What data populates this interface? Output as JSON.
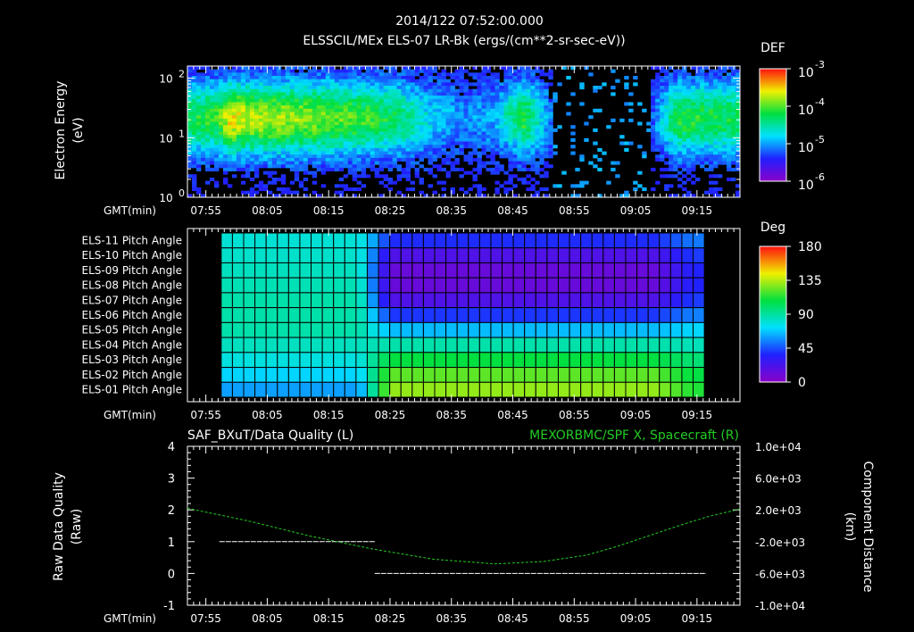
{
  "header": {
    "datetime": "2014/122 07:52:00.000",
    "instrument_title": "ELSSCIL/MEx ELS-07 LR-Bk  (ergs/(cm**2-sr-sec-eV))"
  },
  "colors": {
    "background": "#000000",
    "axes": "#ffffff",
    "series_left": "#ffffff",
    "series_right": "#22cc22"
  },
  "chart_data": [
    {
      "type": "heatmap",
      "panel": "spectrogram",
      "ylabel_line1": "Electron Energy",
      "ylabel_line2": "(eV)",
      "xlabel": "GMT(min)",
      "y_scale": "log",
      "ylim": [
        1,
        160
      ],
      "y_ticks": [
        {
          "label": "10",
          "exp": "0",
          "value": 1
        },
        {
          "label": "10",
          "exp": "1",
          "value": 10
        },
        {
          "label": "10",
          "exp": "2",
          "value": 100
        }
      ],
      "x_ticks": [
        "07:55",
        "08:05",
        "08:15",
        "08:25",
        "08:35",
        "08:45",
        "08:55",
        "09:05",
        "09:15"
      ],
      "colorbar": {
        "title": "DEF",
        "scale": "log",
        "ticks": [
          {
            "base": "10",
            "exp": "-3"
          },
          {
            "base": "10",
            "exp": "-4"
          },
          {
            "base": "10",
            "exp": "-5"
          },
          {
            "base": "10",
            "exp": "-6"
          }
        ]
      },
      "intensity_profile": {
        "time_min": [
          0,
          5,
          7,
          10,
          20,
          30,
          35,
          40,
          45,
          50,
          55,
          60,
          65,
          70,
          75,
          80,
          85,
          89
        ],
        "level": [
          0.55,
          0.6,
          0.85,
          0.75,
          0.7,
          0.6,
          0.5,
          0.3,
          0.2,
          0.25,
          0.6,
          0.1,
          0.05,
          0.05,
          0.05,
          0.6,
          0.55,
          0.55
        ]
      }
    },
    {
      "type": "heatmap",
      "panel": "pitch_angle",
      "xlabel": "GMT(min)",
      "rows": [
        "ELS-11 Pitch Angle",
        "ELS-10 Pitch Angle",
        "ELS-09 Pitch Angle",
        "ELS-08 Pitch Angle",
        "ELS-07 Pitch Angle",
        "ELS-06 Pitch Angle",
        "ELS-05 Pitch Angle",
        "ELS-04 Pitch Angle",
        "ELS-03 Pitch Angle",
        "ELS-02 Pitch Angle",
        "ELS-01 Pitch Angle"
      ],
      "x_ticks": [
        "07:55",
        "08:05",
        "08:15",
        "08:25",
        "08:35",
        "08:45",
        "08:55",
        "09:05",
        "09:15"
      ],
      "colorbar": {
        "title": "Deg",
        "ticks": [
          "180",
          "135",
          "90",
          "45",
          "0"
        ],
        "range": [
          0,
          180
        ]
      },
      "time_columns": {
        "start_min": 5.5,
        "end_min": 84.2,
        "n": 43
      },
      "values_deg_before_0825": [
        80,
        82,
        84,
        86,
        88,
        88,
        88,
        84,
        78,
        70,
        60
      ],
      "values_deg_after_0825": [
        38,
        20,
        12,
        12,
        20,
        40,
        65,
        88,
        108,
        122,
        130
      ]
    },
    {
      "type": "line",
      "panel": "data_quality",
      "title_left": "SAF_BXuT/Data Quality (L)",
      "title_right": "MEXORBMC/SPF X, Spacecraft (R)",
      "ylabel_left_line1": "Raw Data Quality",
      "ylabel_left_line2": "(Raw)",
      "ylabel_right_line1": "Component Distance",
      "ylabel_right_line2": "(km)",
      "xlabel": "GMT(min)",
      "ylim_left": [
        -1,
        4
      ],
      "y_ticks_left": [
        "4",
        "3",
        "2",
        "1",
        "0",
        "-1"
      ],
      "ylim_right": [
        -10000,
        10000
      ],
      "y_ticks_right": [
        "1.0e+04",
        "6.0e+03",
        "2.0e+03",
        "-2.0e+03",
        "-6.0e+03",
        "-1.0e+04"
      ],
      "x_ticks": [
        "07:55",
        "08:05",
        "08:15",
        "08:25",
        "08:35",
        "08:45",
        "08:55",
        "09:05",
        "09:15"
      ],
      "series": [
        {
          "axis": "left",
          "segments": [
            {
              "x_min": [
                5.2,
                30.5
              ],
              "y": 1
            },
            {
              "x_min": [
                30.5,
                84.5
              ],
              "y": 0
            }
          ]
        },
        {
          "name": "MEXORBMC/SPF X, Spacecraft",
          "axis": "right",
          "x_min": [
            0,
            10,
            20,
            30,
            40,
            50,
            58,
            65,
            70,
            75,
            80,
            85,
            90
          ],
          "y": [
            2200,
            600,
            -1300,
            -2900,
            -4200,
            -4800,
            -4500,
            -3700,
            -2600,
            -1300,
            0,
            1200,
            2100
          ]
        }
      ]
    }
  ]
}
